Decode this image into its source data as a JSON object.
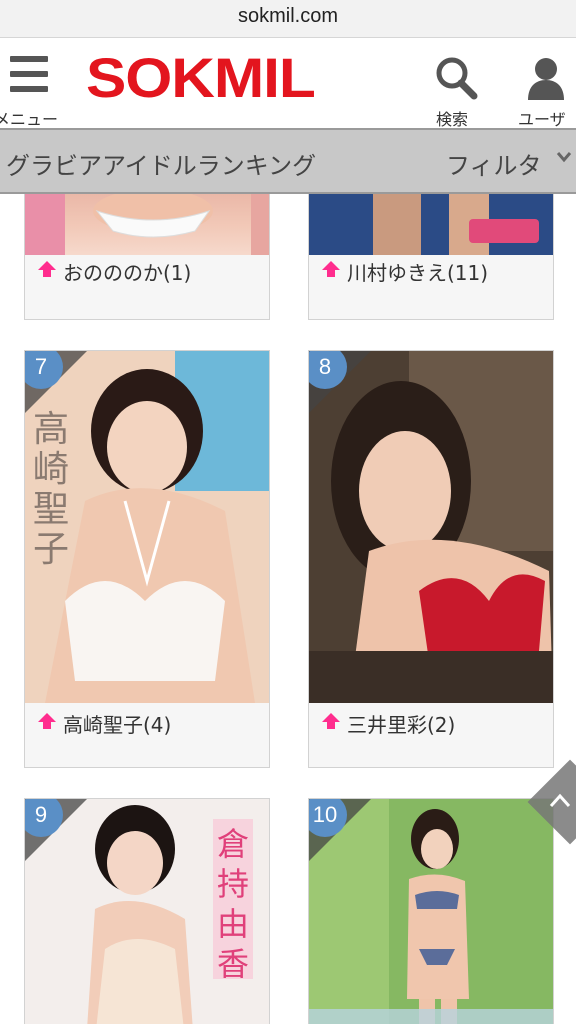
{
  "browser": {
    "url": "sokmil.com"
  },
  "header": {
    "menu_label": "メニュー",
    "logo_text": "SOKMIL",
    "search_label": "検索",
    "user_label": "ユーザ",
    "logo_color": "#e3151e"
  },
  "category_bar": {
    "title": "グラビアアイドルランキング",
    "filter_label": "フィルタ"
  },
  "items": [
    {
      "name": "おのののか(1)",
      "trend": "up"
    },
    {
      "name": "川村ゆきえ(11)",
      "trend": "up"
    },
    {
      "rank": "7",
      "name": "高崎聖子(4)",
      "trend": "up"
    },
    {
      "rank": "8",
      "name": "三井里彩(2)",
      "trend": "up"
    },
    {
      "rank": "9",
      "name": "",
      "trend": ""
    },
    {
      "rank": "10",
      "name": "",
      "trend": ""
    }
  ],
  "colors": {
    "trend_up": "#ff2d8e",
    "rank_badge": "#5a8fc6"
  }
}
